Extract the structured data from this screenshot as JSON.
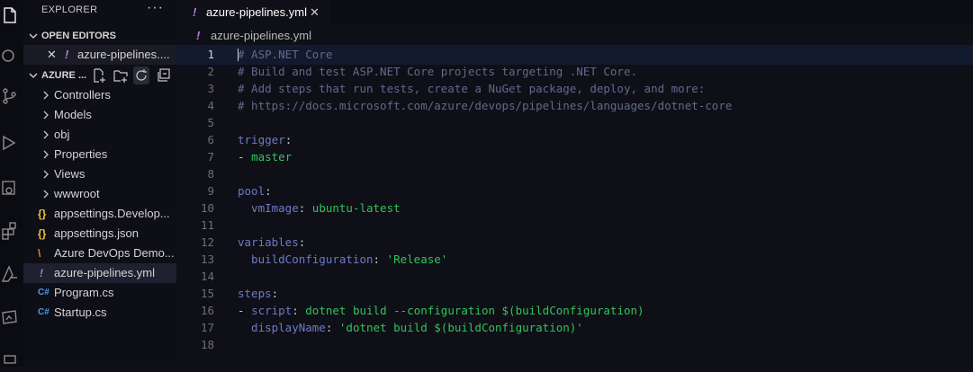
{
  "activity_bar": {
    "icons": [
      "files-icon",
      "search-icon",
      "source-control-icon",
      "run-debug-icon",
      "remote-explorer-icon",
      "extensions-icon",
      "azure-icon",
      "docker-icon"
    ]
  },
  "sidebar": {
    "title": "EXPLORER",
    "more": "···",
    "open_editors": {
      "label": "OPEN EDITORS",
      "items": [
        {
          "close": "✕",
          "icon": "!",
          "name": "azure-pipelines...."
        }
      ]
    },
    "folder": {
      "label": "AZURE ..."
    },
    "tree": [
      {
        "type": "folder",
        "chevron": ">",
        "label": "Controllers"
      },
      {
        "type": "folder",
        "chevron": ">",
        "label": "Models"
      },
      {
        "type": "folder",
        "chevron": ">",
        "label": "obj"
      },
      {
        "type": "folder",
        "chevron": ">",
        "label": "Properties"
      },
      {
        "type": "folder",
        "chevron": ">",
        "label": "Views"
      },
      {
        "type": "folder",
        "chevron": ">",
        "label": "wwwroot"
      },
      {
        "type": "json",
        "icon": "{}",
        "label": "appsettings.Develop..."
      },
      {
        "type": "json",
        "icon": "{}",
        "label": "appsettings.json"
      },
      {
        "type": "rss",
        "icon": "\\",
        "label": "Azure DevOps Demo..."
      },
      {
        "type": "yaml",
        "icon": "!",
        "label": "azure-pipelines.yml",
        "selected": true
      },
      {
        "type": "cs",
        "icon": "C#",
        "label": "Program.cs"
      },
      {
        "type": "cs",
        "icon": "C#",
        "label": "Startup.cs"
      }
    ]
  },
  "tabs": [
    {
      "icon": "!",
      "label": "azure-pipelines.yml",
      "close": "✕",
      "active": true
    }
  ],
  "breadcrumb": {
    "icon": "!",
    "label": "azure-pipelines.yml"
  },
  "editor": {
    "current_line": 1,
    "lines": [
      {
        "n": "1",
        "tokens": [
          {
            "t": "# ASP.NET Core",
            "c": "comment"
          }
        ]
      },
      {
        "n": "2",
        "tokens": [
          {
            "t": "# Build and test ASP.NET Core projects targeting .NET Core.",
            "c": "comment"
          }
        ]
      },
      {
        "n": "3",
        "tokens": [
          {
            "t": "# Add steps that run tests, create a NuGet package, deploy, and more:",
            "c": "comment"
          }
        ]
      },
      {
        "n": "4",
        "tokens": [
          {
            "t": "# https://docs.microsoft.com/azure/devops/pipelines/languages/dotnet-core",
            "c": "comment"
          }
        ]
      },
      {
        "n": "5",
        "tokens": []
      },
      {
        "n": "6",
        "tokens": [
          {
            "t": "trigger",
            "c": "key"
          },
          {
            "t": ":",
            "c": "punc"
          }
        ]
      },
      {
        "n": "7",
        "tokens": [
          {
            "t": "- ",
            "c": "punc"
          },
          {
            "t": "master",
            "c": "str"
          }
        ]
      },
      {
        "n": "8",
        "tokens": []
      },
      {
        "n": "9",
        "tokens": [
          {
            "t": "pool",
            "c": "key"
          },
          {
            "t": ":",
            "c": "punc"
          }
        ]
      },
      {
        "n": "10",
        "tokens": [
          {
            "t": "  vmImage",
            "c": "key"
          },
          {
            "t": ": ",
            "c": "punc"
          },
          {
            "t": "ubuntu-latest",
            "c": "str"
          }
        ]
      },
      {
        "n": "11",
        "tokens": []
      },
      {
        "n": "12",
        "tokens": [
          {
            "t": "variables",
            "c": "key"
          },
          {
            "t": ":",
            "c": "punc"
          }
        ]
      },
      {
        "n": "13",
        "tokens": [
          {
            "t": "  buildConfiguration",
            "c": "key"
          },
          {
            "t": ": ",
            "c": "punc"
          },
          {
            "t": "'Release'",
            "c": "quote"
          }
        ]
      },
      {
        "n": "14",
        "tokens": []
      },
      {
        "n": "15",
        "tokens": [
          {
            "t": "steps",
            "c": "key"
          },
          {
            "t": ":",
            "c": "punc"
          }
        ]
      },
      {
        "n": "16",
        "tokens": [
          {
            "t": "- ",
            "c": "punc"
          },
          {
            "t": "script",
            "c": "key"
          },
          {
            "t": ": ",
            "c": "punc"
          },
          {
            "t": "dotnet build --configuration $(buildConfiguration)",
            "c": "str"
          }
        ]
      },
      {
        "n": "17",
        "tokens": [
          {
            "t": "  displayName",
            "c": "key"
          },
          {
            "t": ": ",
            "c": "punc"
          },
          {
            "t": "'dotnet build $(buildConfiguration)'",
            "c": "quote"
          }
        ]
      },
      {
        "n": "18",
        "tokens": []
      }
    ]
  },
  "colors": {
    "yaml_icon": "#b180d7",
    "json_icon": "#e8c33b",
    "rss_icon": "#e8863b",
    "cs_icon": "#4c9be8",
    "string": "#31c459",
    "key": "#6c7ac6",
    "comment": "#5f6a8e"
  }
}
